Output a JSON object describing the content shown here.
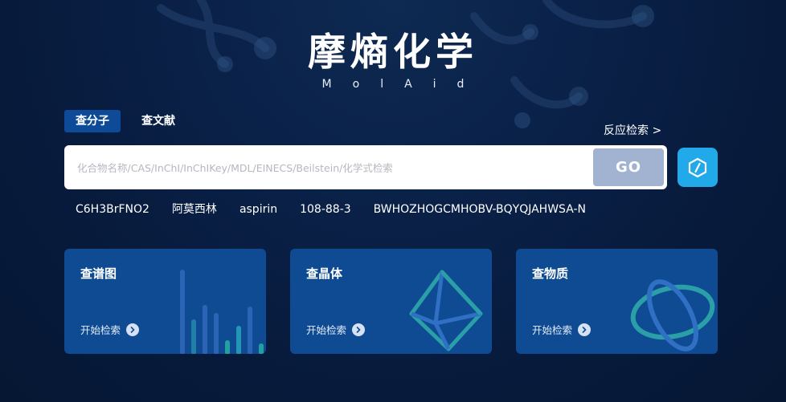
{
  "logo": {
    "cn": "摩熵化学",
    "en": "MolAid"
  },
  "tabs": [
    {
      "label": "查分子",
      "active": true
    },
    {
      "label": "查文献",
      "active": false
    }
  ],
  "reaction_link": "反应检索 >",
  "search": {
    "value": "",
    "placeholder": "化合物名称/CAS/InChI/InChIKey/MDL/EINECS/Beilstein/化学式检索",
    "go_label": "GO"
  },
  "examples": [
    "C6H3BrFNO2",
    "阿莫西林",
    "aspirin",
    "108-88-3",
    "BWHOZHOGCMHOBV-BQYQJAHWSA-N"
  ],
  "cards": [
    {
      "title": "查谱图",
      "action": "开始检索"
    },
    {
      "title": "查晶体",
      "action": "开始检索"
    },
    {
      "title": "查物质",
      "action": "开始检索"
    }
  ],
  "icons": {
    "draw": "structure-draw-icon",
    "arrow": "arrow-right-icon"
  },
  "colors": {
    "background": "#071a3b",
    "accent": "#22a9ea",
    "card": "#0f4b93",
    "go_button": "#a1b3d0",
    "active_tab": "#0d4a97"
  }
}
